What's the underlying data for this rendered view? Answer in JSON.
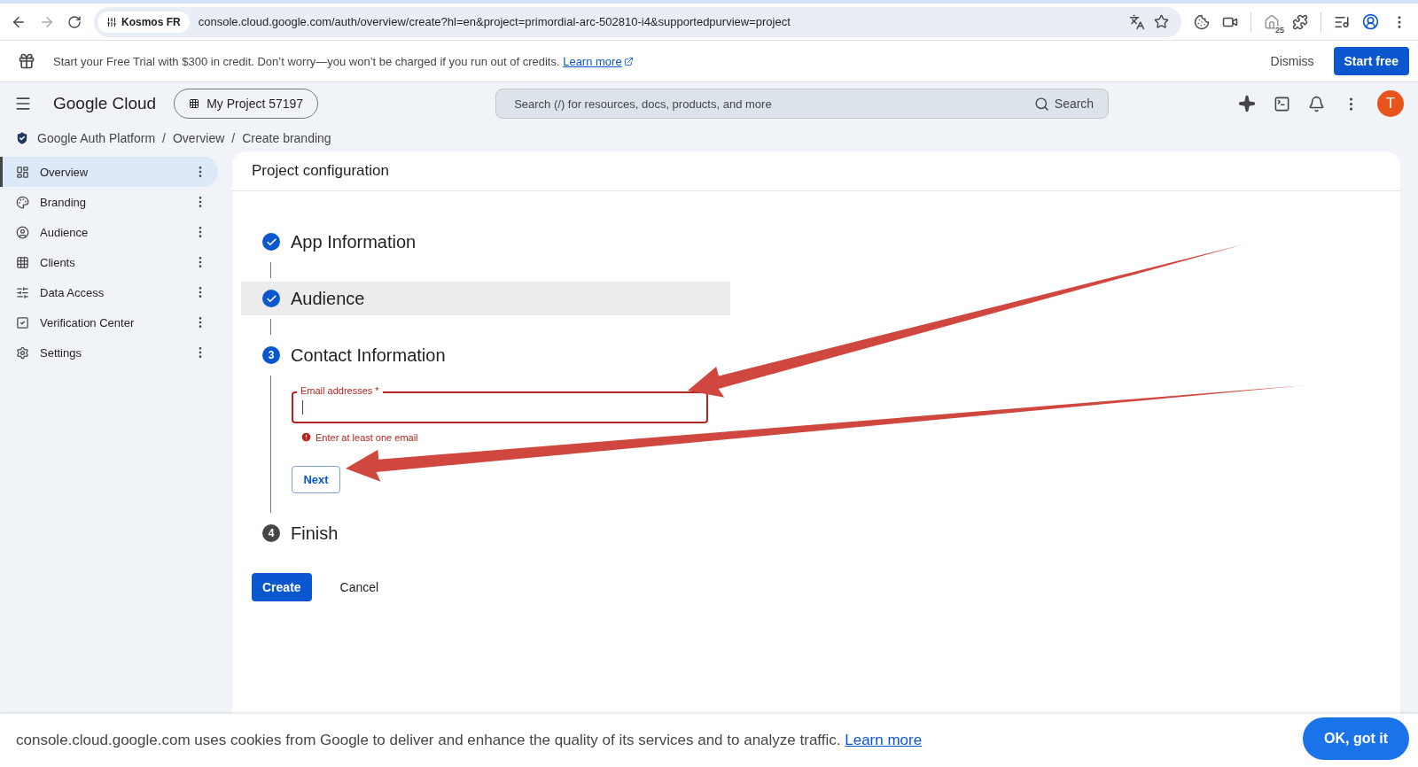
{
  "browser": {
    "site_chip": "Kosmos FR",
    "url": "console.cloud.google.com/auth/overview/create?hl=en&project=primordial-arc-502810-i4&supportedpurview=project",
    "badge": "25"
  },
  "banner": {
    "text": "Start your Free Trial with $300 in credit. Don’t worry—you won’t be charged if you run out of credits.",
    "link": "Learn more",
    "dismiss": "Dismiss",
    "start": "Start free"
  },
  "header": {
    "logo": "Google Cloud",
    "project": "My Project 57197",
    "search_placeholder": "Search (/) for resources, docs, products, and more",
    "search_button": "Search",
    "avatar": "T"
  },
  "breadcrumb": {
    "items": [
      "Google Auth Platform",
      "Overview",
      "Create branding"
    ],
    "separator": "/"
  },
  "sidebar": {
    "items": [
      {
        "label": "Overview",
        "selected": true
      },
      {
        "label": "Branding",
        "selected": false
      },
      {
        "label": "Audience",
        "selected": false
      },
      {
        "label": "Clients",
        "selected": false
      },
      {
        "label": "Data Access",
        "selected": false
      },
      {
        "label": "Verification Center",
        "selected": false
      },
      {
        "label": "Settings",
        "selected": false
      }
    ]
  },
  "page": {
    "title": "Project configuration",
    "steps": [
      {
        "title": "App Information",
        "kind": "done",
        "highlighted": false
      },
      {
        "title": "Audience",
        "kind": "done",
        "highlighted": true
      },
      {
        "title": "Contact Information",
        "kind": "current",
        "number": "3",
        "highlighted": false
      },
      {
        "title": "Finish",
        "kind": "pending",
        "number": "4",
        "highlighted": false
      }
    ],
    "form": {
      "label": "Email addresses *",
      "error": "Enter at least one email",
      "next": "Next"
    },
    "create": "Create",
    "cancel": "Cancel"
  },
  "cookie": {
    "text": "console.cloud.google.com uses cookies from Google to deliver and enhance the quality of its services and to analyze traffic.",
    "link": "Learn more",
    "ok": "OK, got it"
  }
}
